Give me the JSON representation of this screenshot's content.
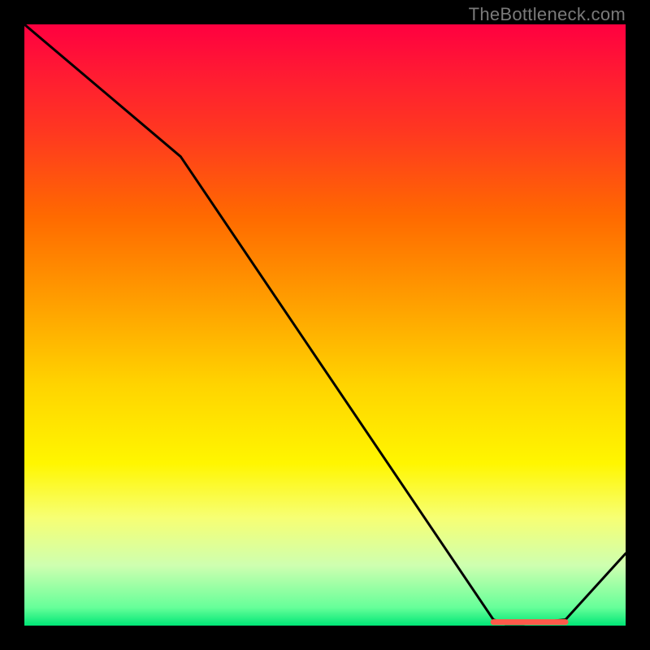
{
  "attribution": "TheBottleneck.com",
  "chart_data": {
    "type": "line",
    "title": "",
    "xlabel": "",
    "ylabel": "",
    "ylim": [
      0,
      100
    ],
    "background_gradient": {
      "top": "#ff0040",
      "mid_high": "#ff9e00",
      "mid_low": "#fff600",
      "bottom": "#00e676"
    },
    "series": [
      {
        "name": "curve",
        "x": [
          0,
          26,
          78,
          80,
          83,
          90,
          100
        ],
        "values": [
          100,
          78,
          1,
          0.3,
          0.3,
          1,
          12
        ]
      },
      {
        "name": "highlight-band",
        "x": [
          78,
          90
        ],
        "values": [
          0.6,
          0.6
        ],
        "kind": "plateau-marker",
        "color": "#ff5a4a"
      }
    ]
  }
}
